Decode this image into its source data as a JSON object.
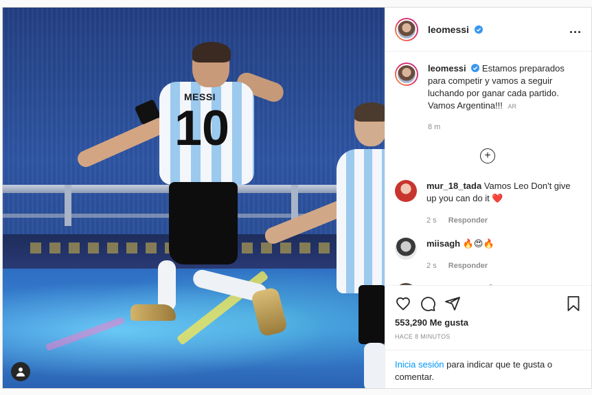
{
  "post": {
    "username": "leomessi",
    "more_label": "...",
    "caption_text": "Estamos preparados para competir y vamos a seguir luchando por ganar cada partido. Vamos Argentina!!!",
    "translate_tag": "AR",
    "caption_time": "8 m",
    "photo": {
      "jersey_name": "MESSI",
      "jersey_number": "10"
    }
  },
  "comments": [
    {
      "username": "mur_18_tada",
      "text": "Vamos Leo Don't give up you can do it ❤️",
      "time": "2 s",
      "reply_label": "Responder",
      "avatar_color": "#c8352f"
    },
    {
      "username": "miisagh",
      "text": "🔥😍🔥",
      "time": "2 s",
      "reply_label": "Responder",
      "avatar_color": "#6b6b6b"
    },
    {
      "username": "hamletotanez",
      "text": "😱",
      "time": "",
      "reply_label": "",
      "avatar_color": "#9a8a7a"
    }
  ],
  "footer": {
    "likes": "553,290 Me gusta",
    "posted_ago": "HACE 8 MINUTOS",
    "login_link": "Inicia sesión",
    "login_rest": "para indicar que te gusta o comentar."
  },
  "icons": [
    "heart-icon",
    "comment-icon",
    "share-icon",
    "bookmark-icon",
    "verified-icon",
    "add-icon",
    "user-tag-icon"
  ],
  "colors": {
    "link": "#0095f6",
    "verified": "#3897f0",
    "meta": "#8e8e8e"
  }
}
